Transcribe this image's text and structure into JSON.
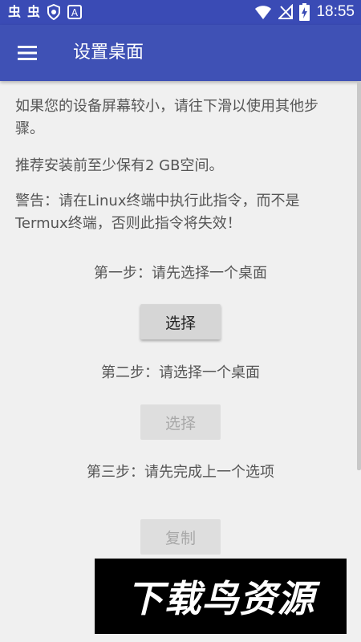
{
  "statusbar": {
    "left_glyphs": [
      "虫",
      "虫"
    ],
    "badge_a": "A",
    "time": "18:55"
  },
  "appbar": {
    "title": "设置桌面"
  },
  "content": {
    "para1": "如果您的设备屏幕较小，请往下滑以使用其他步骤。",
    "para2": "推荐安装前至少保有2 GB空间。",
    "para3": "警告：请在Linux终端中执行此指令，而不是Termux终端，否则此指令将失效！",
    "step1_label": "第一步：请先选择一个桌面",
    "step1_button": "选择",
    "step2_label": "第二步：请选择一个桌面",
    "step2_button": "选择",
    "step3_label": "第三步：请先完成上一个选项",
    "copy_button": "复制"
  },
  "watermark": {
    "text": "下载鸟资源"
  },
  "colors": {
    "statusbar": "#3a4bb5",
    "appbar": "#3f51b5",
    "background": "#f0f0f0"
  }
}
